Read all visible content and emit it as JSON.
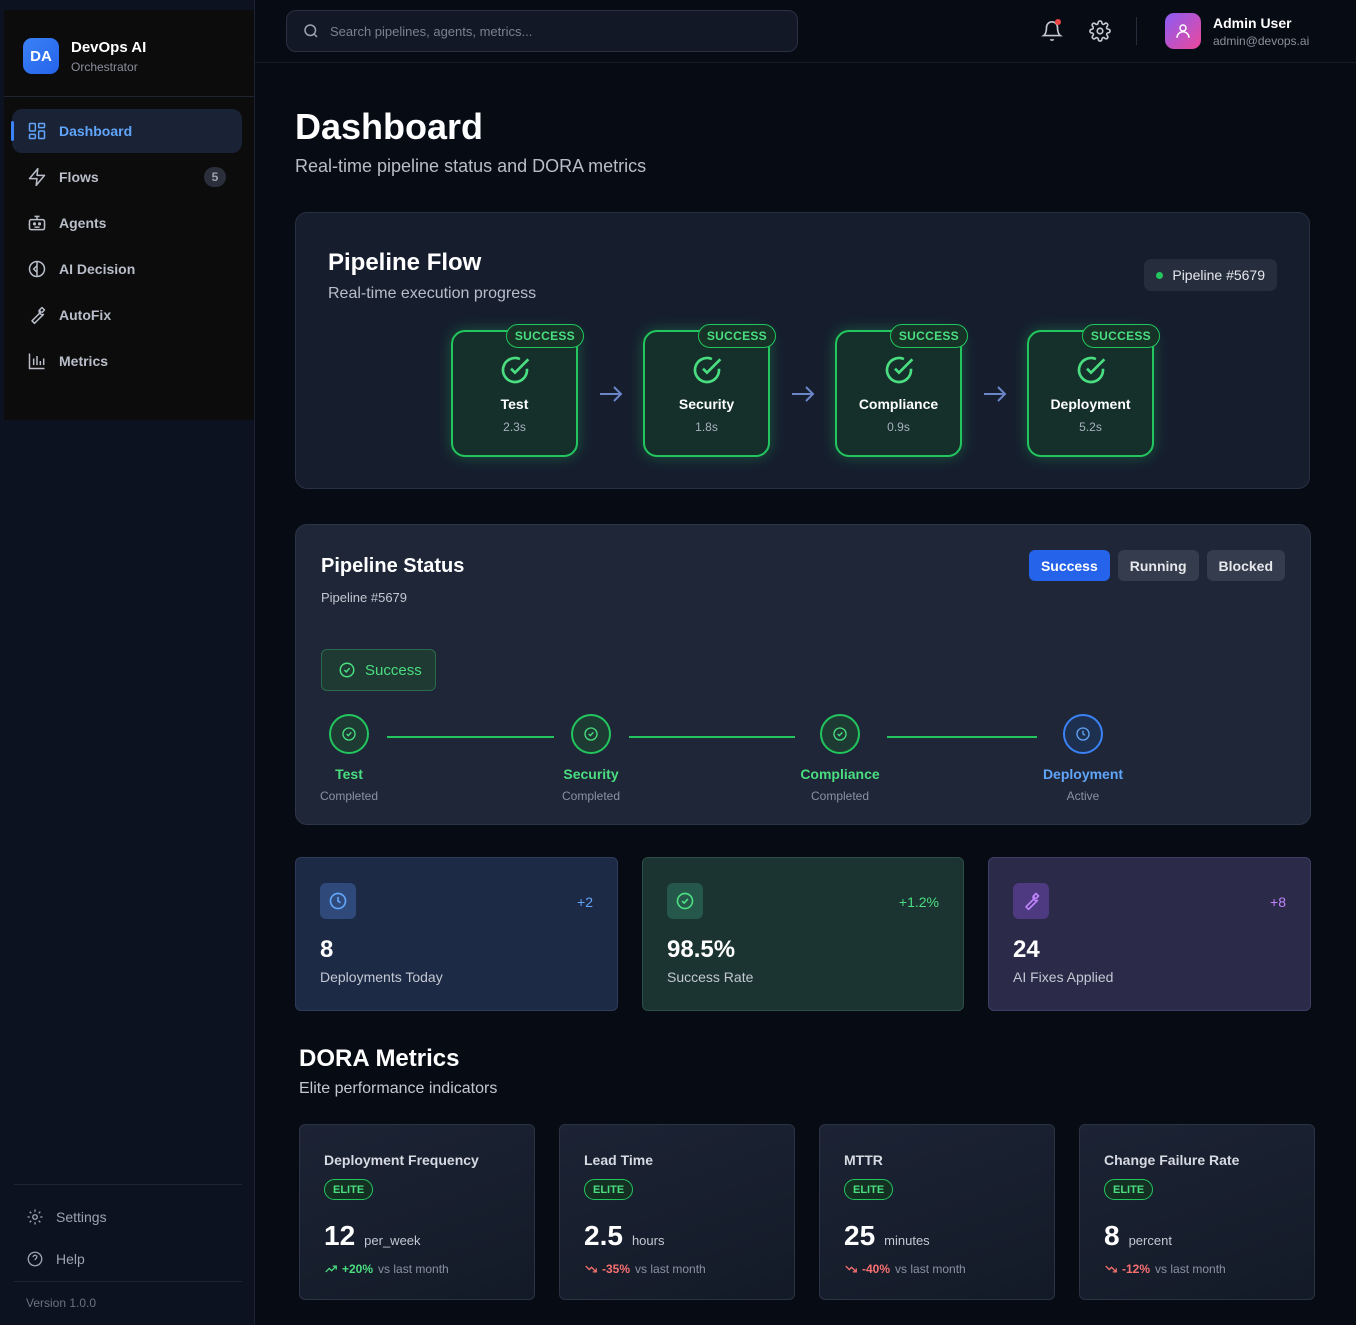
{
  "brand": {
    "logo": "DA",
    "name": "DevOps AI",
    "subtitle": "Orchestrator"
  },
  "sidebar": {
    "items": [
      {
        "label": "Dashboard",
        "icon": "grid-icon",
        "active": true
      },
      {
        "label": "Flows",
        "icon": "lightning-icon",
        "badge": "5"
      },
      {
        "label": "Agents",
        "icon": "robot-icon"
      },
      {
        "label": "AI Decision",
        "icon": "split-circle-icon"
      },
      {
        "label": "AutoFix",
        "icon": "wrench-icon"
      },
      {
        "label": "Metrics",
        "icon": "bar-chart-icon"
      }
    ],
    "bottom": [
      {
        "label": "Settings",
        "icon": "gear-icon"
      },
      {
        "label": "Help",
        "icon": "help-circle-icon"
      }
    ],
    "version": "Version 1.0.0"
  },
  "header": {
    "search_placeholder": "Search pipelines, agents, metrics...",
    "user": {
      "name": "Admin User",
      "email": "admin@devops.ai"
    }
  },
  "page": {
    "title": "Dashboard",
    "subtitle": "Real-time pipeline status and DORA metrics"
  },
  "pipeline_flow": {
    "title": "Pipeline Flow",
    "subtitle": "Real-time execution progress",
    "pipeline_label": "Pipeline #5679",
    "stages": [
      {
        "name": "Test",
        "time": "2.3s",
        "status": "SUCCESS"
      },
      {
        "name": "Security",
        "time": "1.8s",
        "status": "SUCCESS"
      },
      {
        "name": "Compliance",
        "time": "0.9s",
        "status": "SUCCESS"
      },
      {
        "name": "Deployment",
        "time": "5.2s",
        "status": "SUCCESS"
      }
    ]
  },
  "pipeline_status": {
    "title": "Pipeline Status",
    "subtitle": "Pipeline #5679",
    "tabs": [
      "Success",
      "Running",
      "Blocked"
    ],
    "active_tab": "Success",
    "status_label": "Success",
    "steps": [
      {
        "name": "Test",
        "state": "Completed"
      },
      {
        "name": "Security",
        "state": "Completed"
      },
      {
        "name": "Compliance",
        "state": "Completed"
      },
      {
        "name": "Deployment",
        "state": "Active"
      }
    ]
  },
  "stats": [
    {
      "value": "8",
      "label": "Deployments Today",
      "delta": "+2",
      "icon": "clock-icon",
      "color": "#60a5fa"
    },
    {
      "value": "98.5%",
      "label": "Success Rate",
      "delta": "+1.2%",
      "icon": "check-circle-icon",
      "color": "#4ade80"
    },
    {
      "value": "24",
      "label": "AI Fixes Applied",
      "delta": "+8",
      "icon": "wrench-icon",
      "color": "#c084fc"
    }
  ],
  "dora": {
    "title": "DORA Metrics",
    "subtitle": "Elite performance indicators",
    "metrics": [
      {
        "name": "Deployment Frequency",
        "level": "ELITE",
        "value": "12",
        "unit": "per_week",
        "trend": "+20%",
        "direction": "up",
        "note": "vs last month"
      },
      {
        "name": "Lead Time",
        "level": "ELITE",
        "value": "2.5",
        "unit": "hours",
        "trend": "-35%",
        "direction": "down",
        "note": "vs last month"
      },
      {
        "name": "MTTR",
        "level": "ELITE",
        "value": "25",
        "unit": "minutes",
        "trend": "-40%",
        "direction": "down",
        "note": "vs last month"
      },
      {
        "name": "Change Failure Rate",
        "level": "ELITE",
        "value": "8",
        "unit": "percent",
        "trend": "-12%",
        "direction": "down",
        "note": "vs last month"
      }
    ]
  },
  "colors": {
    "accent": "#3b82f6",
    "success": "#22c55e",
    "danger": "#f87171",
    "purple": "#c084fc"
  }
}
